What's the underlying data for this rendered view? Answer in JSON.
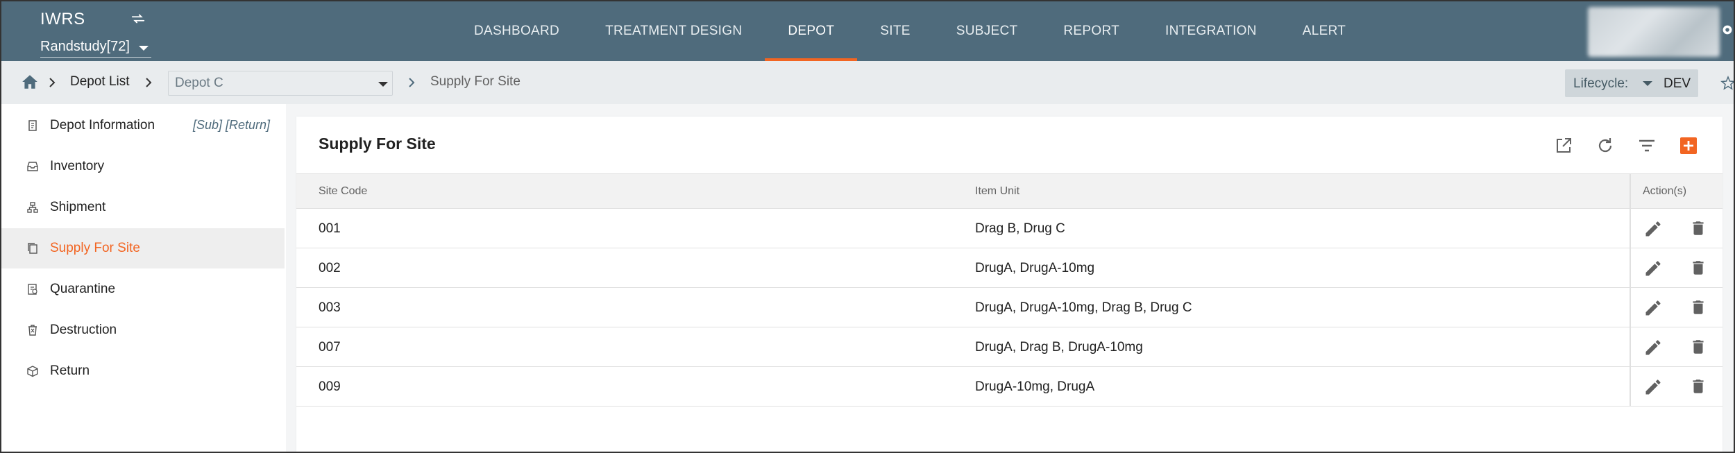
{
  "header": {
    "app_title": "IWRS",
    "swap_icon": "swap-icon",
    "study": "Randstudy[72]",
    "nav": [
      {
        "label": "DASHBOARD",
        "active": false
      },
      {
        "label": "TREATMENT DESIGN",
        "active": false
      },
      {
        "label": "DEPOT",
        "active": true
      },
      {
        "label": "SITE",
        "active": false
      },
      {
        "label": "SUBJECT",
        "active": false
      },
      {
        "label": "REPORT",
        "active": false
      },
      {
        "label": "INTEGRATION",
        "active": false
      },
      {
        "label": "ALERT",
        "active": false
      }
    ],
    "accent_color": "#f26522",
    "bar_color": "#4f6b7c"
  },
  "breadcrumb": {
    "home_icon": "home-icon",
    "depot_list": "Depot List",
    "depot_select": "Depot C",
    "current": "Supply For Site",
    "lifecycle_label": "Lifecycle:",
    "lifecycle_value": "DEV"
  },
  "sidebar": {
    "items": [
      {
        "label": "Depot Information",
        "icon": "document-icon",
        "active": false,
        "extra": "[Sub] [Return]"
      },
      {
        "label": "Inventory",
        "icon": "inbox-icon",
        "active": false
      },
      {
        "label": "Shipment",
        "icon": "hierarchy-icon",
        "active": false
      },
      {
        "label": "Supply For Site",
        "icon": "copy-icon",
        "active": true
      },
      {
        "label": "Quarantine",
        "icon": "quarantine-icon",
        "active": false
      },
      {
        "label": "Destruction",
        "icon": "trash-icon",
        "active": false
      },
      {
        "label": "Return",
        "icon": "package-icon",
        "active": false
      }
    ]
  },
  "main": {
    "title": "Supply For Site",
    "toolbar": [
      "open-external-icon",
      "refresh-icon",
      "filter-icon",
      "add-icon"
    ],
    "columns": [
      "Site Code",
      "Item Unit",
      "Action(s)"
    ],
    "rows": [
      {
        "site_code": "001",
        "item_unit": "Drag B, Drug C"
      },
      {
        "site_code": "002",
        "item_unit": "DrugA, DrugA-10mg"
      },
      {
        "site_code": "003",
        "item_unit": "DrugA, DrugA-10mg, Drag B, Drug C"
      },
      {
        "site_code": "007",
        "item_unit": "DrugA, Drag B, DrugA-10mg"
      },
      {
        "site_code": "009",
        "item_unit": "DrugA-10mg, DrugA"
      }
    ]
  }
}
